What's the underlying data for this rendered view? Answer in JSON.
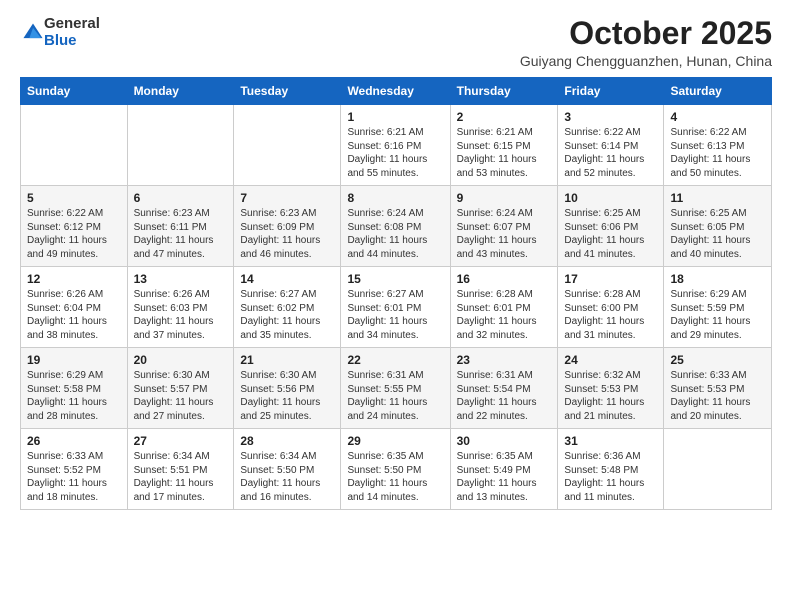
{
  "header": {
    "logo_general": "General",
    "logo_blue": "Blue",
    "month_title": "October 2025",
    "location": "Guiyang Chengguanzhen, Hunan, China"
  },
  "days_of_week": [
    "Sunday",
    "Monday",
    "Tuesday",
    "Wednesday",
    "Thursday",
    "Friday",
    "Saturday"
  ],
  "weeks": [
    [
      {
        "day": "",
        "sunrise": "",
        "sunset": "",
        "daylight": ""
      },
      {
        "day": "",
        "sunrise": "",
        "sunset": "",
        "daylight": ""
      },
      {
        "day": "",
        "sunrise": "",
        "sunset": "",
        "daylight": ""
      },
      {
        "day": "1",
        "sunrise": "Sunrise: 6:21 AM",
        "sunset": "Sunset: 6:16 PM",
        "daylight": "Daylight: 11 hours and 55 minutes."
      },
      {
        "day": "2",
        "sunrise": "Sunrise: 6:21 AM",
        "sunset": "Sunset: 6:15 PM",
        "daylight": "Daylight: 11 hours and 53 minutes."
      },
      {
        "day": "3",
        "sunrise": "Sunrise: 6:22 AM",
        "sunset": "Sunset: 6:14 PM",
        "daylight": "Daylight: 11 hours and 52 minutes."
      },
      {
        "day": "4",
        "sunrise": "Sunrise: 6:22 AM",
        "sunset": "Sunset: 6:13 PM",
        "daylight": "Daylight: 11 hours and 50 minutes."
      }
    ],
    [
      {
        "day": "5",
        "sunrise": "Sunrise: 6:22 AM",
        "sunset": "Sunset: 6:12 PM",
        "daylight": "Daylight: 11 hours and 49 minutes."
      },
      {
        "day": "6",
        "sunrise": "Sunrise: 6:23 AM",
        "sunset": "Sunset: 6:11 PM",
        "daylight": "Daylight: 11 hours and 47 minutes."
      },
      {
        "day": "7",
        "sunrise": "Sunrise: 6:23 AM",
        "sunset": "Sunset: 6:09 PM",
        "daylight": "Daylight: 11 hours and 46 minutes."
      },
      {
        "day": "8",
        "sunrise": "Sunrise: 6:24 AM",
        "sunset": "Sunset: 6:08 PM",
        "daylight": "Daylight: 11 hours and 44 minutes."
      },
      {
        "day": "9",
        "sunrise": "Sunrise: 6:24 AM",
        "sunset": "Sunset: 6:07 PM",
        "daylight": "Daylight: 11 hours and 43 minutes."
      },
      {
        "day": "10",
        "sunrise": "Sunrise: 6:25 AM",
        "sunset": "Sunset: 6:06 PM",
        "daylight": "Daylight: 11 hours and 41 minutes."
      },
      {
        "day": "11",
        "sunrise": "Sunrise: 6:25 AM",
        "sunset": "Sunset: 6:05 PM",
        "daylight": "Daylight: 11 hours and 40 minutes."
      }
    ],
    [
      {
        "day": "12",
        "sunrise": "Sunrise: 6:26 AM",
        "sunset": "Sunset: 6:04 PM",
        "daylight": "Daylight: 11 hours and 38 minutes."
      },
      {
        "day": "13",
        "sunrise": "Sunrise: 6:26 AM",
        "sunset": "Sunset: 6:03 PM",
        "daylight": "Daylight: 11 hours and 37 minutes."
      },
      {
        "day": "14",
        "sunrise": "Sunrise: 6:27 AM",
        "sunset": "Sunset: 6:02 PM",
        "daylight": "Daylight: 11 hours and 35 minutes."
      },
      {
        "day": "15",
        "sunrise": "Sunrise: 6:27 AM",
        "sunset": "Sunset: 6:01 PM",
        "daylight": "Daylight: 11 hours and 34 minutes."
      },
      {
        "day": "16",
        "sunrise": "Sunrise: 6:28 AM",
        "sunset": "Sunset: 6:01 PM",
        "daylight": "Daylight: 11 hours and 32 minutes."
      },
      {
        "day": "17",
        "sunrise": "Sunrise: 6:28 AM",
        "sunset": "Sunset: 6:00 PM",
        "daylight": "Daylight: 11 hours and 31 minutes."
      },
      {
        "day": "18",
        "sunrise": "Sunrise: 6:29 AM",
        "sunset": "Sunset: 5:59 PM",
        "daylight": "Daylight: 11 hours and 29 minutes."
      }
    ],
    [
      {
        "day": "19",
        "sunrise": "Sunrise: 6:29 AM",
        "sunset": "Sunset: 5:58 PM",
        "daylight": "Daylight: 11 hours and 28 minutes."
      },
      {
        "day": "20",
        "sunrise": "Sunrise: 6:30 AM",
        "sunset": "Sunset: 5:57 PM",
        "daylight": "Daylight: 11 hours and 27 minutes."
      },
      {
        "day": "21",
        "sunrise": "Sunrise: 6:30 AM",
        "sunset": "Sunset: 5:56 PM",
        "daylight": "Daylight: 11 hours and 25 minutes."
      },
      {
        "day": "22",
        "sunrise": "Sunrise: 6:31 AM",
        "sunset": "Sunset: 5:55 PM",
        "daylight": "Daylight: 11 hours and 24 minutes."
      },
      {
        "day": "23",
        "sunrise": "Sunrise: 6:31 AM",
        "sunset": "Sunset: 5:54 PM",
        "daylight": "Daylight: 11 hours and 22 minutes."
      },
      {
        "day": "24",
        "sunrise": "Sunrise: 6:32 AM",
        "sunset": "Sunset: 5:53 PM",
        "daylight": "Daylight: 11 hours and 21 minutes."
      },
      {
        "day": "25",
        "sunrise": "Sunrise: 6:33 AM",
        "sunset": "Sunset: 5:53 PM",
        "daylight": "Daylight: 11 hours and 20 minutes."
      }
    ],
    [
      {
        "day": "26",
        "sunrise": "Sunrise: 6:33 AM",
        "sunset": "Sunset: 5:52 PM",
        "daylight": "Daylight: 11 hours and 18 minutes."
      },
      {
        "day": "27",
        "sunrise": "Sunrise: 6:34 AM",
        "sunset": "Sunset: 5:51 PM",
        "daylight": "Daylight: 11 hours and 17 minutes."
      },
      {
        "day": "28",
        "sunrise": "Sunrise: 6:34 AM",
        "sunset": "Sunset: 5:50 PM",
        "daylight": "Daylight: 11 hours and 16 minutes."
      },
      {
        "day": "29",
        "sunrise": "Sunrise: 6:35 AM",
        "sunset": "Sunset: 5:50 PM",
        "daylight": "Daylight: 11 hours and 14 minutes."
      },
      {
        "day": "30",
        "sunrise": "Sunrise: 6:35 AM",
        "sunset": "Sunset: 5:49 PM",
        "daylight": "Daylight: 11 hours and 13 minutes."
      },
      {
        "day": "31",
        "sunrise": "Sunrise: 6:36 AM",
        "sunset": "Sunset: 5:48 PM",
        "daylight": "Daylight: 11 hours and 11 minutes."
      },
      {
        "day": "",
        "sunrise": "",
        "sunset": "",
        "daylight": ""
      }
    ]
  ]
}
